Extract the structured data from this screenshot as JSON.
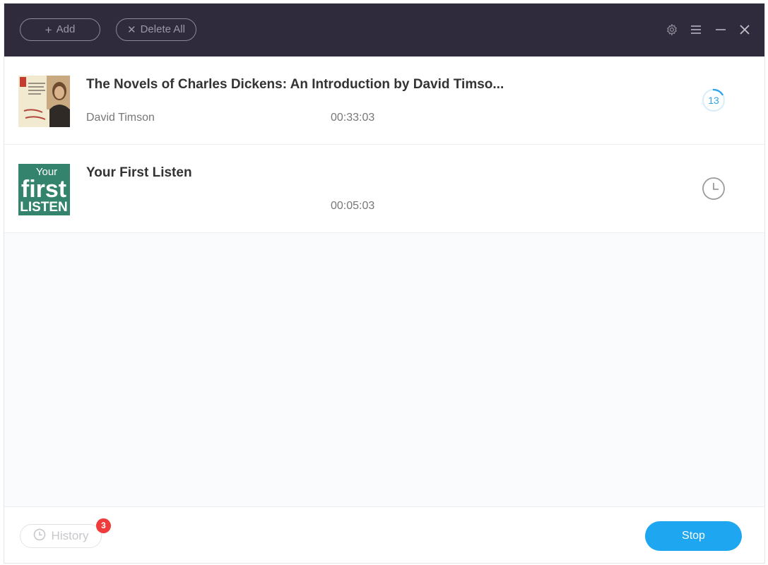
{
  "toolbar": {
    "add_label": "Add",
    "delete_all_label": "Delete All",
    "icons": {
      "add": "plus-icon",
      "delete_all": "x-icon",
      "settings": "gear-icon",
      "menu": "hamburger-menu-icon",
      "minimize": "minimize-icon",
      "close": "close-icon"
    }
  },
  "items": [
    {
      "title": "The Novels of Charles Dickens: An Introduction by David Timso...",
      "author": "David Timson",
      "duration": "00:33:03",
      "status": "converting",
      "progress": "13",
      "cover_icon": "dickens-book-cover"
    },
    {
      "title": "Your First Listen",
      "author": "",
      "duration": "00:05:03",
      "status": "waiting",
      "cover_icon": "your-first-listen-cover",
      "cover_text": {
        "line1": "Your",
        "line2": "first",
        "line3": "LISTEN"
      }
    }
  ],
  "footer": {
    "history_label": "History",
    "history_badge": "3",
    "stop_label": "Stop",
    "icons": {
      "history": "clock-icon"
    }
  },
  "colors": {
    "titlebar": "#2f2b3c",
    "accent": "#1ea7f0",
    "badge": "#ef3b3b"
  }
}
